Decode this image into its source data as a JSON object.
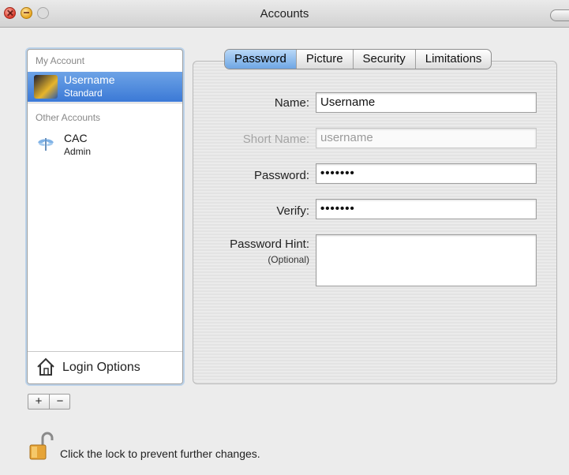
{
  "window": {
    "title": "Accounts"
  },
  "sidebar": {
    "my_account_label": "My Account",
    "my_account": {
      "name": "Username",
      "role": "Standard"
    },
    "other_accounts_label": "Other Accounts",
    "other_accounts": [
      {
        "name": "CAC",
        "role": "Admin"
      }
    ],
    "login_options_label": "Login Options"
  },
  "buttons": {
    "add": "+",
    "remove": "−"
  },
  "tabs": [
    {
      "label": "Password",
      "selected": true
    },
    {
      "label": "Picture",
      "selected": false
    },
    {
      "label": "Security",
      "selected": false
    },
    {
      "label": "Limitations",
      "selected": false
    }
  ],
  "form": {
    "name": {
      "label": "Name:",
      "value": "Username"
    },
    "short_name": {
      "label": "Short Name:",
      "value": "username"
    },
    "password": {
      "label": "Password:",
      "value": "•••••••"
    },
    "verify": {
      "label": "Verify:",
      "value": "•••••••"
    },
    "hint": {
      "label": "Password Hint:",
      "optional": "(Optional)",
      "value": ""
    }
  },
  "lock": {
    "message": "Click the lock to prevent further changes."
  },
  "colors": {
    "selection": "#3b79d6",
    "tab_active": "#6ea6e4"
  }
}
